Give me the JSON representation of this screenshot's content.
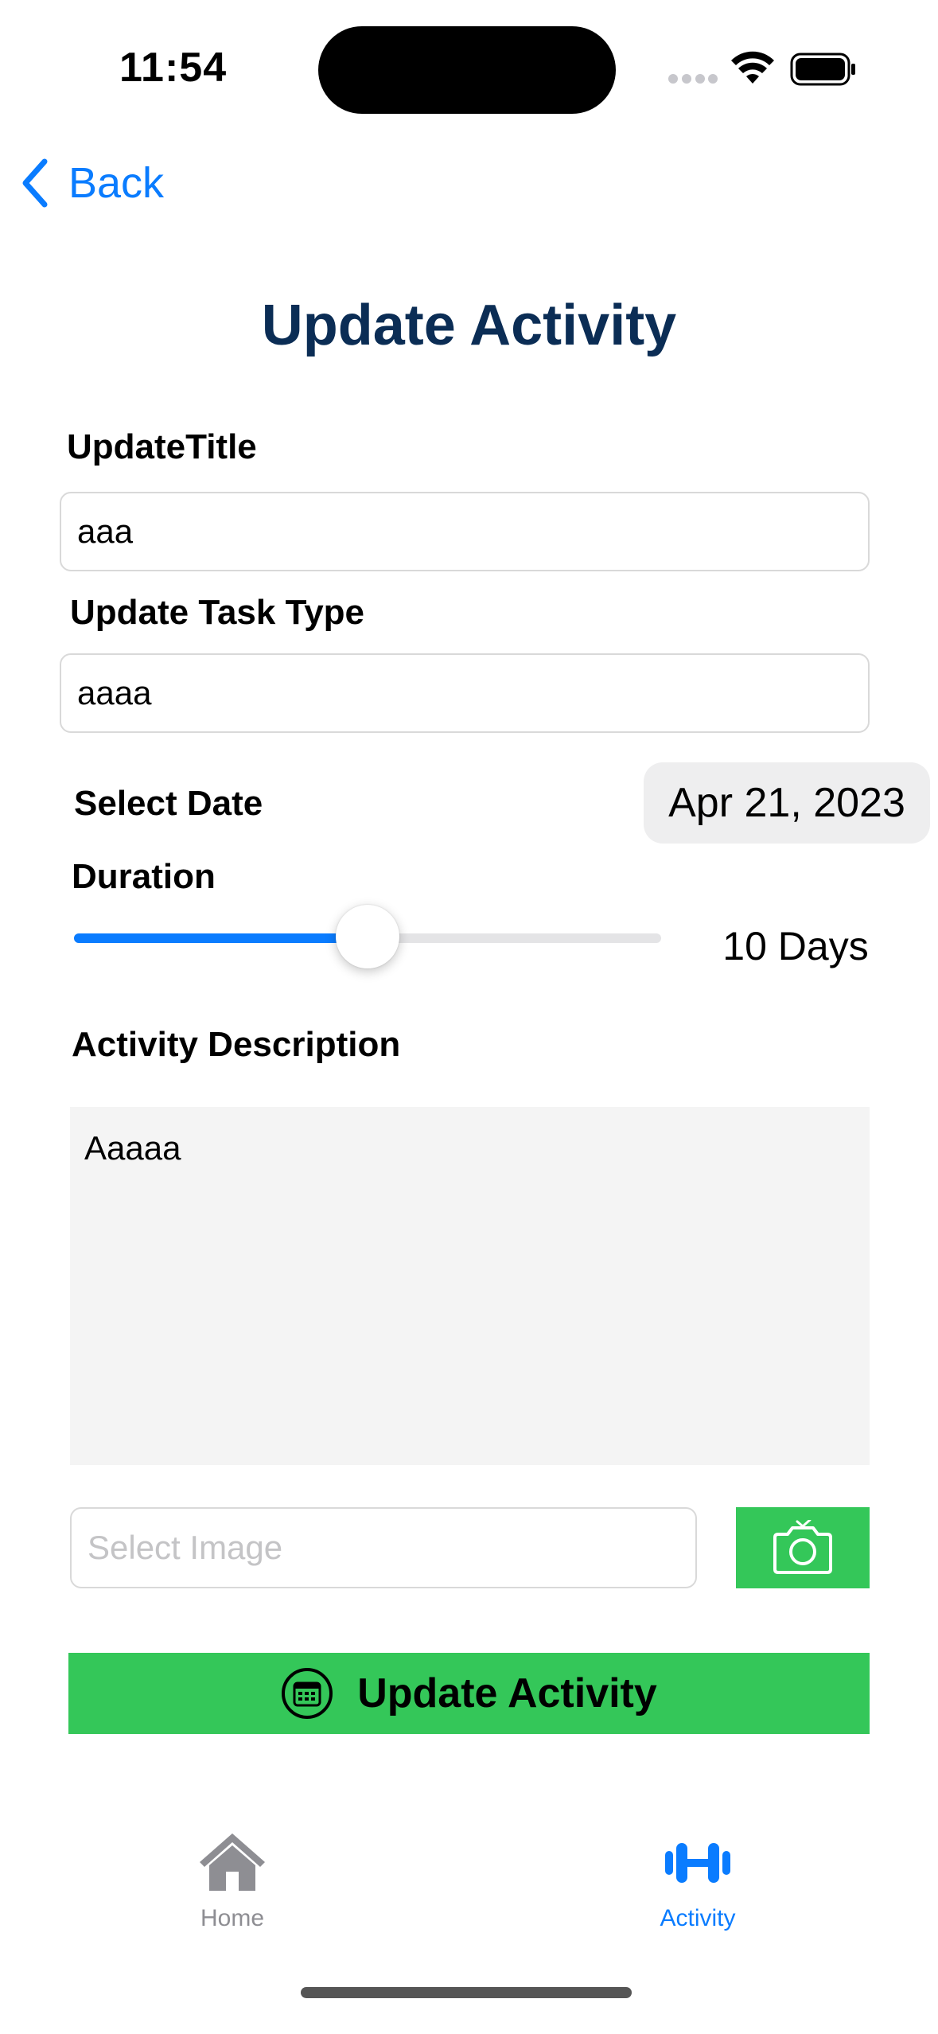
{
  "status_bar": {
    "time": "11:54"
  },
  "nav": {
    "back_label": "Back"
  },
  "page": {
    "title": "Update Activity"
  },
  "form": {
    "title_label": "UpdateTitle",
    "title_value": "aaa",
    "task_type_label": "Update Task Type",
    "task_type_value": "aaaa",
    "date_label": "Select Date",
    "date_value": "Apr 21, 2023",
    "duration_label": "Duration",
    "duration_value": "10 Days",
    "duration_slider_fraction": 0.5,
    "description_label": "Activity Description",
    "description_value": "Aaaaa",
    "image_placeholder": "Select Image",
    "submit_label": "Update Activity"
  },
  "tab_bar": {
    "items": [
      {
        "label": "Home",
        "icon": "house-icon",
        "active": false
      },
      {
        "label": "Activity",
        "icon": "dumbbell-icon",
        "active": true
      }
    ]
  },
  "colors": {
    "accent": "#0a7cff",
    "title": "#0b2d55",
    "green": "#34c759",
    "inactive_tab": "#8e8e93"
  }
}
